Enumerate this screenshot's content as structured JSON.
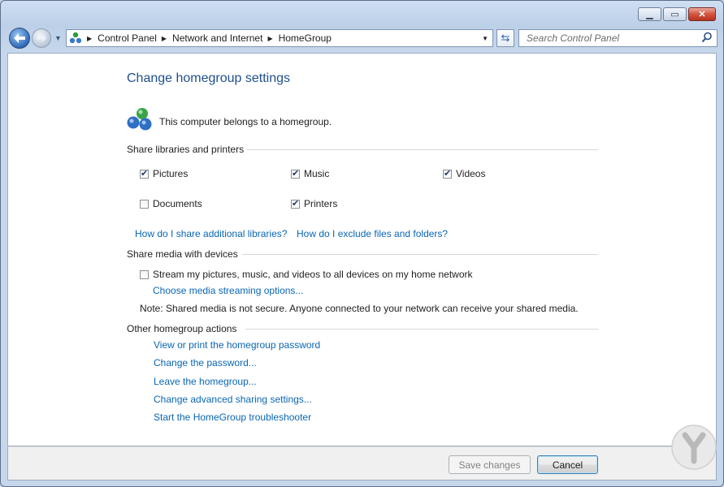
{
  "window": {
    "caption_buttons": [
      "minimize",
      "maximize",
      "close"
    ]
  },
  "nav": {
    "breadcrumb": [
      "Control Panel",
      "Network and Internet",
      "HomeGroup"
    ],
    "search_placeholder": "Search Control Panel"
  },
  "page": {
    "title": "Change homegroup settings",
    "status": "This computer belongs to a homegroup."
  },
  "share_libraries": {
    "heading": "Share libraries and printers",
    "items": [
      {
        "label": "Pictures",
        "checked": true
      },
      {
        "label": "Music",
        "checked": true
      },
      {
        "label": "Videos",
        "checked": true
      },
      {
        "label": "Documents",
        "checked": false
      },
      {
        "label": "Printers",
        "checked": true
      }
    ],
    "link_additional": "How do I share additional libraries?",
    "link_exclude": "How do I exclude files and folders?"
  },
  "share_media": {
    "heading": "Share media with devices",
    "stream_label": "Stream my pictures, music, and videos to all devices on my home network",
    "stream_checked": false,
    "link_options": "Choose media streaming options...",
    "note": "Note: Shared media is not secure. Anyone connected to your network can receive your shared media."
  },
  "other_actions": {
    "heading": "Other homegroup actions",
    "links": [
      "View or print the homegroup password",
      "Change the password...",
      "Leave the homegroup...",
      "Change advanced sharing settings...",
      "Start the HomeGroup troubleshooter"
    ]
  },
  "footer": {
    "save_label": "Save changes",
    "cancel_label": "Cancel"
  },
  "colors": {
    "link": "#0a66b4",
    "title": "#1f4f8f",
    "content_bg": "#ffffff",
    "frame": "#c6d7ec"
  }
}
